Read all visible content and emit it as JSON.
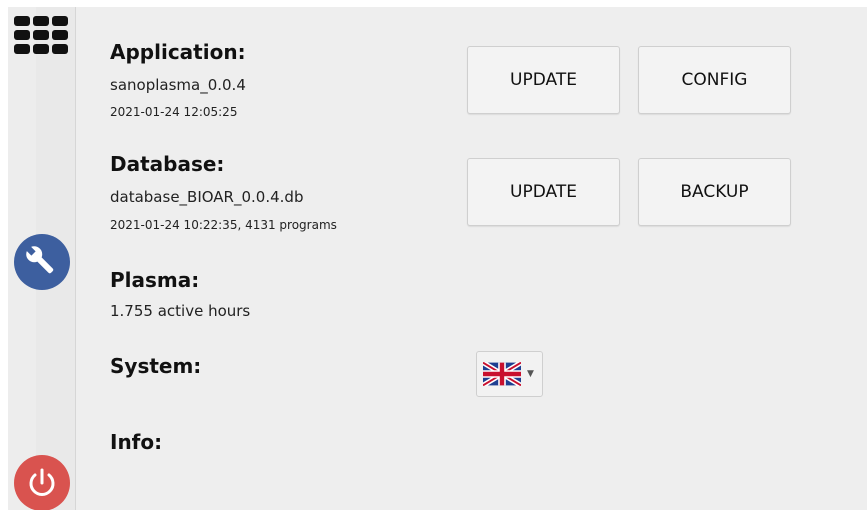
{
  "sections": {
    "application": {
      "title": "Application:",
      "name": "sanoplasma_0.0.4",
      "timestamp": "2021-01-24 12:05:25"
    },
    "database": {
      "title": "Database:",
      "name": "database_BIOAR_0.0.4.db",
      "details": "2021-01-24 10:22:35, 4131 programs"
    },
    "plasma": {
      "title": "Plasma:",
      "value": "1.755 active hours"
    },
    "system": {
      "title": "System:",
      "language": {
        "selected": "en-GB",
        "icon": "uk-flag-icon"
      }
    },
    "info": {
      "title": "Info:"
    }
  },
  "buttons": {
    "app_update": "UPDATE",
    "app_config": "CONFIG",
    "db_update": "UPDATE",
    "db_backup": "BACKUP"
  },
  "sidebar": {
    "top_icon": "grid-menu-icon",
    "middle_icon": "wrench-icon",
    "bottom_icon": "power-icon"
  },
  "colors": {
    "wrench_button": "#3d5f9f",
    "power_button": "#d9534f",
    "background": "#eeeeee"
  }
}
